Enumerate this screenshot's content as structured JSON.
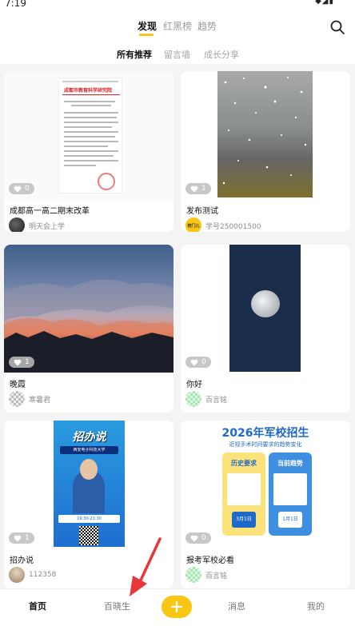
{
  "status": {
    "time": "7:19",
    "icons": "◆◢▮"
  },
  "top_tabs": [
    "发现",
    "红黑榜",
    "趋势"
  ],
  "sub_tabs": [
    "所有推荐",
    "留言墙",
    "成长分享"
  ],
  "doc_header": "成都市教育科学研究院",
  "poster2_heading": "招办说",
  "poster2_sub": "西安电子科技大学",
  "poster2_time": "19:30-21:30",
  "poster3": {
    "title": "2026年军校招生",
    "subtitle": "近视手术时间要求的趋势变化",
    "history": "历史要求",
    "current": "当前趋势",
    "date1": "3月1日",
    "date2": "1月1日"
  },
  "cards": [
    {
      "likes": "0",
      "title": "成都高一高二期末改革",
      "author": "明天会上学"
    },
    {
      "likes": "1",
      "title": "发布测试",
      "author": "学号250001500",
      "badge": "校门儿"
    },
    {
      "likes": "1",
      "title": "晚霞",
      "author": "寒暑君"
    },
    {
      "likes": "0",
      "title": "你好",
      "author": "百言铭"
    },
    {
      "likes": "1",
      "title": "招办说",
      "author": "112358"
    },
    {
      "likes": "0",
      "title": "报考军校必看",
      "author": "百言铭"
    }
  ],
  "bottom_tabs": [
    "首页",
    "百晓生",
    "消息",
    "我的"
  ],
  "colors": {
    "accent": "#f9c614",
    "background": "#f4f4f5"
  }
}
